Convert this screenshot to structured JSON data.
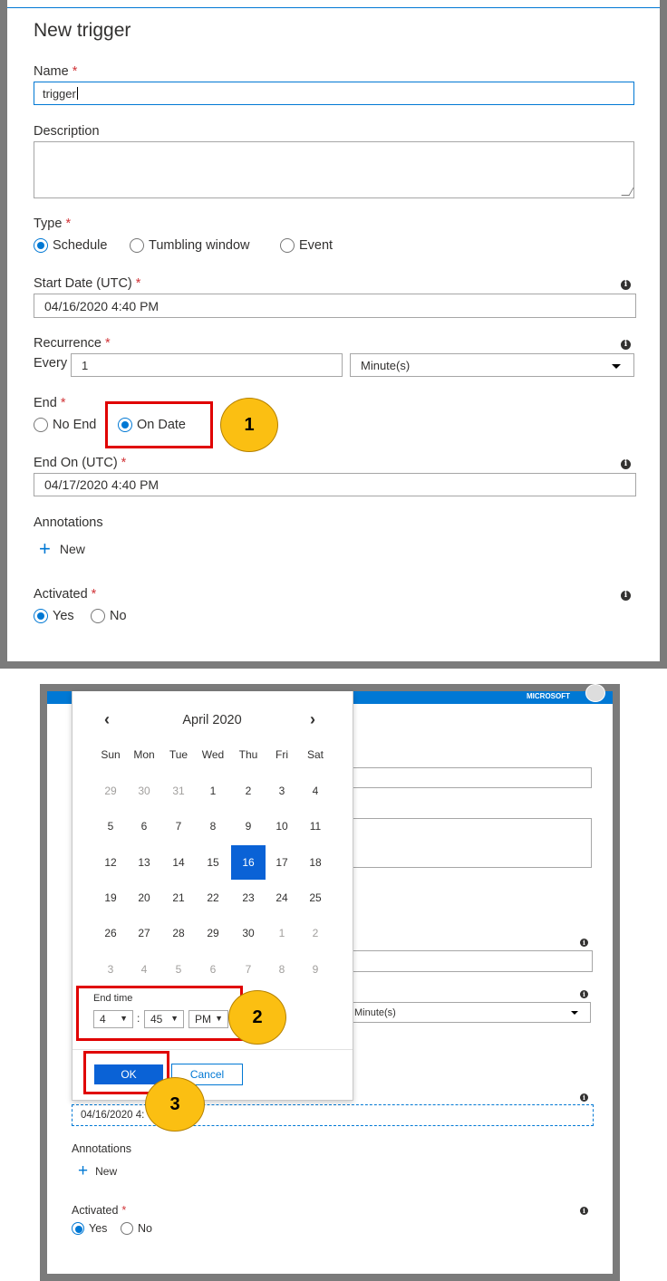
{
  "top_panel": {
    "title": "New trigger",
    "name_label": "Name",
    "name_value": "trigger",
    "description_label": "Description",
    "type_label": "Type",
    "type_options": [
      "Schedule",
      "Tumbling window",
      "Event"
    ],
    "start_date_label": "Start Date (UTC)",
    "start_date_value": "04/16/2020 4:40 PM",
    "recurrence_label": "Recurrence",
    "every_label": "Every",
    "every_value": "1",
    "unit_value": "Minute(s)",
    "end_label": "End",
    "end_options": [
      "No End",
      "On Date"
    ],
    "end_on_label": "End On (UTC)",
    "end_on_value": "04/17/2020 4:40 PM",
    "annotations_label": "Annotations",
    "new_label": "New",
    "activated_label": "Activated",
    "activated_options": [
      "Yes",
      "No"
    ],
    "required_mark": "*"
  },
  "callouts": {
    "one": "1",
    "two": "2",
    "three": "3"
  },
  "bottom_panel": {
    "header_text": "MICROSOFT",
    "calendar": {
      "month_label": "April 2020",
      "prev_icon": "chevron-left",
      "next_icon": "chevron-right",
      "days_of_week": [
        "Sun",
        "Mon",
        "Tue",
        "Wed",
        "Thu",
        "Fri",
        "Sat"
      ],
      "weeks": [
        [
          "29",
          "30",
          "31",
          "1",
          "2",
          "3",
          "4"
        ],
        [
          "5",
          "6",
          "7",
          "8",
          "9",
          "10",
          "11"
        ],
        [
          "12",
          "13",
          "14",
          "15",
          "16",
          "17",
          "18"
        ],
        [
          "19",
          "20",
          "21",
          "22",
          "23",
          "24",
          "25"
        ],
        [
          "26",
          "27",
          "28",
          "29",
          "30",
          "1",
          "2"
        ],
        [
          "3",
          "4",
          "5",
          "6",
          "7",
          "8",
          "9"
        ]
      ],
      "selected_day": "16",
      "end_time_label": "End time",
      "hour_value": "4",
      "minute_value": "45",
      "ampm_value": "PM",
      "time_separator": ":",
      "ok_label": "OK",
      "cancel_label": "Cancel"
    },
    "unit_value": "Minute(s)",
    "end_on_value": "04/16/2020 4:",
    "annotations_label": "Annotations",
    "new_label": "New",
    "activated_label": "Activated",
    "activated_options": [
      "Yes",
      "No"
    ],
    "required_mark": "*"
  },
  "colors": {
    "accent": "#0078d4",
    "selected_day": "#0a62d6",
    "callout": "#fbbf12",
    "highlight": "#e00000"
  }
}
